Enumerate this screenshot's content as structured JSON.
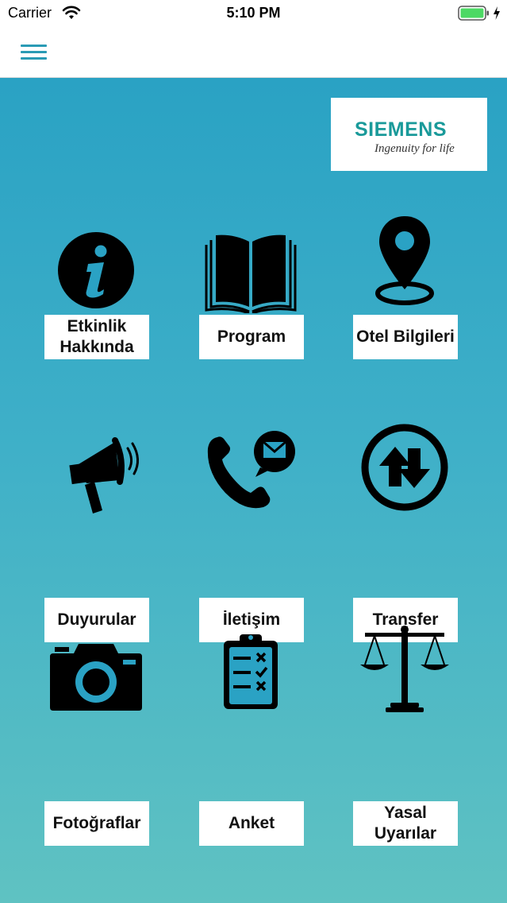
{
  "status_bar": {
    "carrier": "Carrier",
    "time": "5:10 PM",
    "battery_color": "#4cd964"
  },
  "header": {
    "menu_icon": "hamburger-menu-icon",
    "accent_color": "#2a9bb5"
  },
  "logo": {
    "brand": "SIEMENS",
    "tagline": "Ingenuity for life",
    "brand_color": "#1a9a9a"
  },
  "grid": {
    "tiles": [
      {
        "label": "Etkinlik Hakkında",
        "icon": "info-icon"
      },
      {
        "label": "Program",
        "icon": "book-icon"
      },
      {
        "label": "Otel Bilgileri",
        "icon": "location-pin-icon"
      },
      {
        "label": "Duyurular",
        "icon": "megaphone-icon"
      },
      {
        "label": "İletişim",
        "icon": "phone-message-icon"
      },
      {
        "label": "Transfer",
        "icon": "transfer-arrows-icon"
      },
      {
        "label": "Fotoğraflar",
        "icon": "camera-icon"
      },
      {
        "label": "Anket",
        "icon": "clipboard-checklist-icon"
      },
      {
        "label": "Yasal Uyarılar",
        "icon": "scales-icon"
      }
    ]
  }
}
